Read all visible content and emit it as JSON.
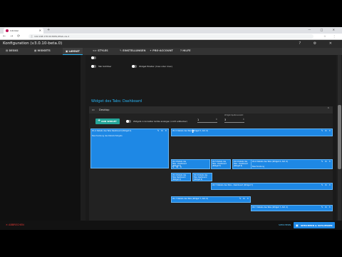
{
  "browser": {
    "tab_title": "Iobroker",
    "url": "192.168.178.99:8081/#tab-vis-2",
    "new_tab": "+",
    "window_controls": "— □ ✕",
    "toolbar_icons": "☆ ⋮"
  },
  "app": {
    "title": "Konfiguration (v3.0.10-beta.0)",
    "header_icons": "? ⚙ ✕"
  },
  "nav_tabs": [
    {
      "label": "DESKS",
      "icon": "desk-icon"
    },
    {
      "label": "WIDGETS",
      "icon": "widgets-icon"
    },
    {
      "label": "LAYOUT",
      "icon": "layout-icon"
    },
    {
      "label": "STYLES",
      "icon": "styles-icon"
    },
    {
      "label": "EINSTELLUNGEN",
      "icon": "settings-icon"
    },
    {
      "label": "PRO-ACCOUNT",
      "icon": "account-icon"
    },
    {
      "label": "HILFE",
      "icon": "help-icon"
    }
  ],
  "options": {
    "row1_label": "",
    "row2_left": "Tab Sichtbar",
    "row2_right": "Widget Breiter (max oder max)"
  },
  "section_title": "Widget des Tabs: Dashboard",
  "panel": {
    "label": "Desktop",
    "add_button": "ADD WIDGET",
    "toggle_label": "Widgets in korrekter Größe anzeigen (nicht editierbar)",
    "input1": {
      "label": "",
      "value": "1"
    },
    "input2": {
      "label": "Widget-Spaltenanzahl",
      "value": "3"
    }
  },
  "widgets": [
    {
      "title": "#1.4 Details des Tabs Dashboard (Widget 4)",
      "body": "Beschreibung des Details Widgets"
    },
    {
      "title": "#1.5 Details des Tabs (Widget 5, Abt. 6)",
      "body": "Beschreibung"
    },
    {
      "title": "#1.6 Details des Tabs (Widget 6, Abt. 6)",
      "body": "Beschreibung"
    },
    {
      "title": "#2.4 Details des Tabs - Dashboard (Widget 4)",
      "body": ""
    },
    {
      "title": "#2.5 Details des Tabs - Dashboard (Widget 5)",
      "body": ""
    },
    {
      "title": "#2.6 Details des Tabs - Dashboard (Widget 6)",
      "body": ""
    },
    {
      "title": "#2.4 Details des Tabs Dashboard (Widget 4)",
      "body": ""
    },
    {
      "title": "#2.6 Details des Tabs Dashboard (Widget 6)",
      "body": ""
    },
    {
      "title": "#2.7 Details des Tabs - Dashboard (Widget 7)",
      "body": ""
    },
    {
      "title": "#1.7 Details des Tabs (Widget 7, Abt. 6)",
      "body": ""
    },
    {
      "title": "#2.7 Details des Tabs (Widget 7, Abt. 2)",
      "body": ""
    },
    {
      "title": "#1.8 Details des Tabs (Widget 8, Abt. 6)",
      "body": ""
    },
    {
      "title": "#1.8 Details des Tabs (Widget 8, Abt. 2)",
      "body": ""
    },
    {
      "title": "#1.9 Details des Tabs (Widget 9, Abt. 6)",
      "body": ""
    },
    {
      "title": "#2.8 Details des Tabs (Widget 8, Abt. 2)",
      "body": ""
    },
    {
      "title": "#2.9 Details des Tabs (Widget 9, Abt. 2)",
      "body": ""
    }
  ],
  "statusbar": {
    "left": "✕ ABBRECHEN",
    "link": "SPEICHERN",
    "button": "SPEICHERN & SCHLIESSEN"
  },
  "colors": {
    "accent": "#29b6f6",
    "widget": "#1e88e5",
    "add_button": "#26a69a",
    "cancel": "#e53935"
  }
}
